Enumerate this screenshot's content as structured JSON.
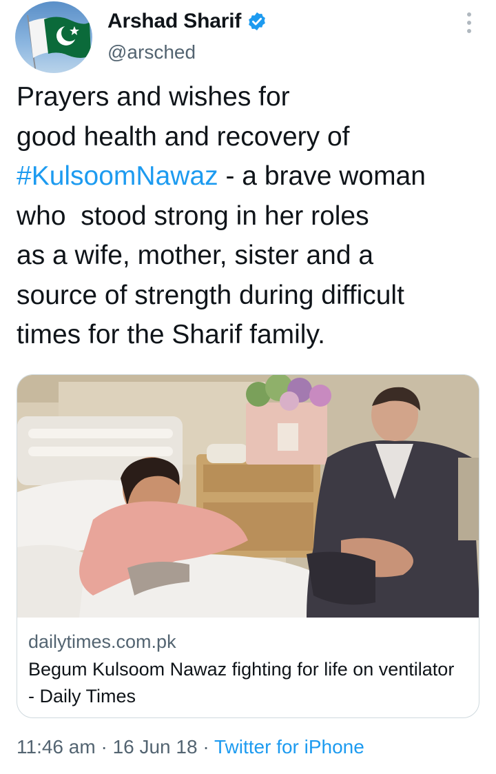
{
  "author": {
    "name": "Arshad Sharif",
    "handle": "@arsched",
    "avatar_icon": "pakistan-flag-icon",
    "verified_icon": "verified-badge-icon"
  },
  "tweet": {
    "text_lines": [
      "Prayers and wishes for",
      "good health and recovery of",
      {
        "hashtag": "#KulsoomNawaz",
        "rest": " - a brave woman"
      },
      "who  stood strong in her roles",
      "as a wife, mother, sister and a",
      "source of strength during difficult",
      "times for the Sharif family."
    ]
  },
  "card": {
    "domain": "dailytimes.com.pk",
    "title": "Begum Kulsoom Nawaz fighting for life on ventilator - Daily Times"
  },
  "meta": {
    "time": "11:46 am",
    "separator": "·",
    "date": "16 Jun 18",
    "source": "Twitter for iPhone"
  },
  "colors": {
    "link": "#1d9bf0",
    "secondary_text": "#536471",
    "verified": "#1d9bf0"
  }
}
